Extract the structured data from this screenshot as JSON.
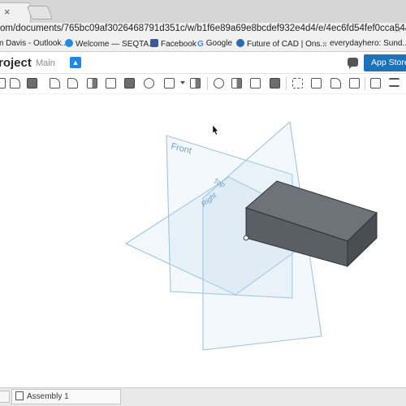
{
  "browser": {
    "tab_close": "×",
    "url_path": "om/documents/765bc09af3026468791d351c/w/b1f6e89a69e8bcdef932e4d4/e/4ec6fd54fef0cca54a64..."
  },
  "bookmarks": [
    {
      "label": "m Davis - Outlook...",
      "icon": "outlook-icon",
      "color": "#3a5dae"
    },
    {
      "label": "Welcome — SEQTA...",
      "icon": "seqta-icon",
      "color": "#1e8ae6"
    },
    {
      "label": "Facebook",
      "icon": "facebook-icon",
      "color": "#3b5998"
    },
    {
      "label": "Google",
      "icon": "google-icon",
      "color": "#4285f4"
    },
    {
      "label": "Future of CAD | Ons...",
      "icon": "onshape-icon",
      "color": "#2b6cb0"
    },
    {
      "label": "everydayhero: Sund...",
      "icon": "heart-icon",
      "color": "#b9b9b9"
    }
  ],
  "app": {
    "project_title": "roject",
    "branch": "Main",
    "app_store_label": "App Store"
  },
  "canvas": {
    "plane_front": "Front",
    "plane_top": "Top",
    "plane_right": "Right",
    "plane_color": "#9ec6e0",
    "box_color": "#5f646b"
  },
  "bottom": {
    "assembly_tab": "Assembly 1"
  }
}
